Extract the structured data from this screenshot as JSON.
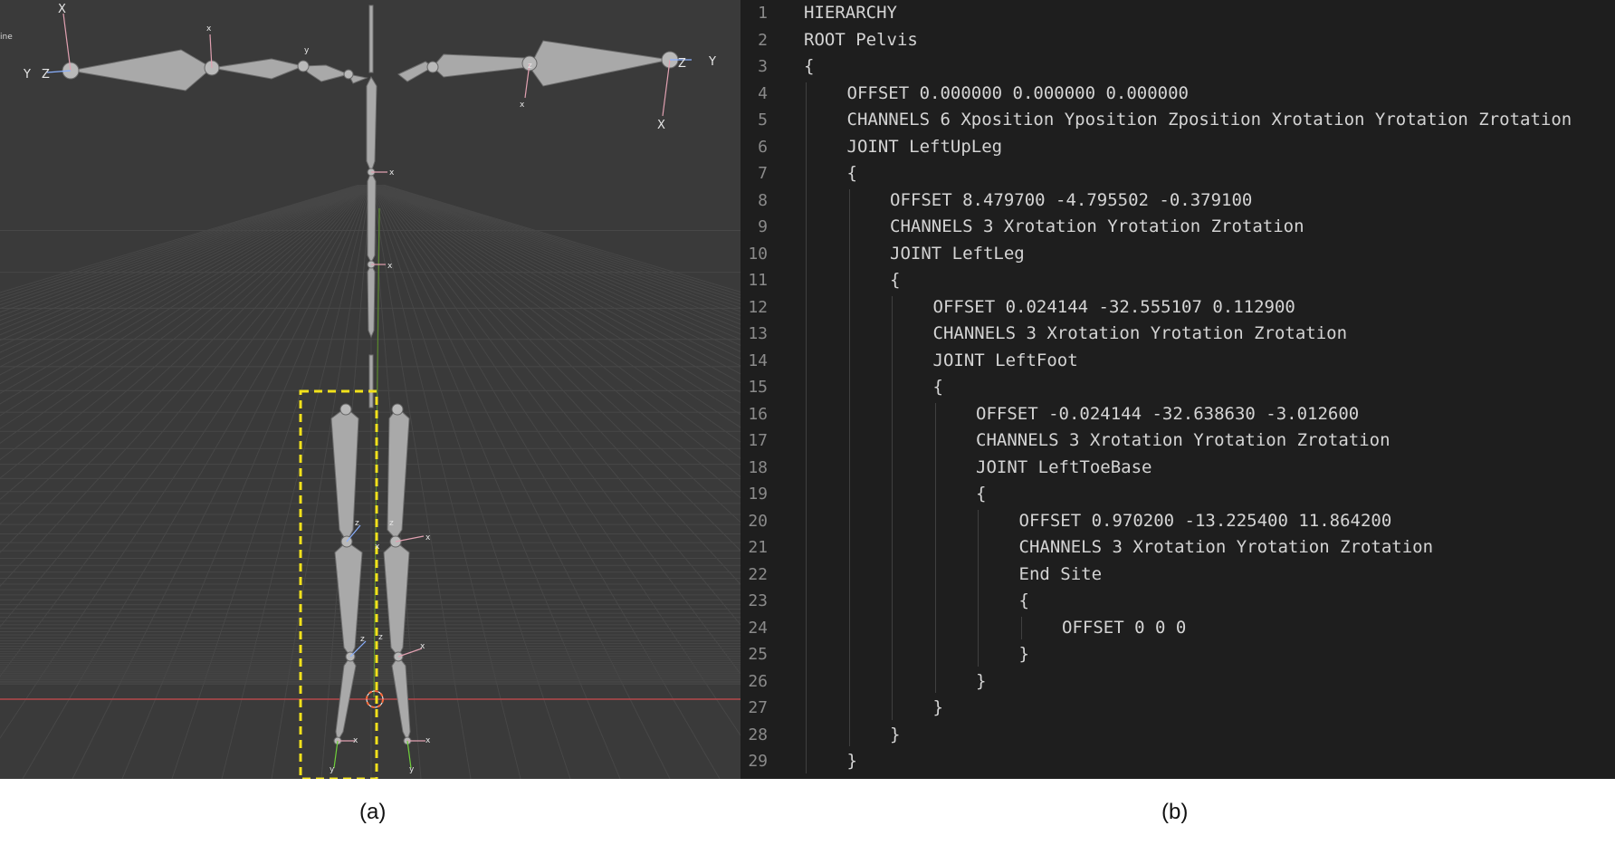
{
  "viewport": {
    "corner_text": "ine",
    "axis_labels": {
      "x": "X",
      "y": "Y",
      "z": "Z",
      "x_small": "x",
      "y_small": "y",
      "z_small": "z"
    },
    "colors": {
      "background": "#3a3a3a",
      "grid": "#4c4c4c",
      "bone": "#a9a9a9",
      "axis_x": "#ff5a5a",
      "axis_y": "#6fcf3b",
      "axis_z": "#6b8cff",
      "highlight_box": "#f2e11b"
    }
  },
  "editor": {
    "lines": [
      {
        "n": "1",
        "text": "HIERARCHY",
        "indent": 0
      },
      {
        "n": "2",
        "text": "ROOT Pelvis",
        "indent": 0
      },
      {
        "n": "3",
        "text": "{",
        "indent": 0
      },
      {
        "n": "4",
        "text": "OFFSET 0.000000 0.000000 0.000000",
        "indent": 1
      },
      {
        "n": "5",
        "text": "CHANNELS 6 Xposition Yposition Zposition Xrotation Yrotation Zrotation",
        "indent": 1
      },
      {
        "n": "6",
        "text": "JOINT LeftUpLeg",
        "indent": 1
      },
      {
        "n": "7",
        "text": "{",
        "indent": 1
      },
      {
        "n": "8",
        "text": "OFFSET 8.479700 -4.795502 -0.379100",
        "indent": 2
      },
      {
        "n": "9",
        "text": "CHANNELS 3 Xrotation Yrotation Zrotation",
        "indent": 2
      },
      {
        "n": "10",
        "text": "JOINT LeftLeg",
        "indent": 2
      },
      {
        "n": "11",
        "text": "{",
        "indent": 2
      },
      {
        "n": "12",
        "text": "OFFSET 0.024144 -32.555107 0.112900",
        "indent": 3
      },
      {
        "n": "13",
        "text": "CHANNELS 3 Xrotation Yrotation Zrotation",
        "indent": 3
      },
      {
        "n": "14",
        "text": "JOINT LeftFoot",
        "indent": 3
      },
      {
        "n": "15",
        "text": "{",
        "indent": 3
      },
      {
        "n": "16",
        "text": "OFFSET -0.024144 -32.638630 -3.012600",
        "indent": 4
      },
      {
        "n": "17",
        "text": "CHANNELS 3 Xrotation Yrotation Zrotation",
        "indent": 4
      },
      {
        "n": "18",
        "text": "JOINT LeftToeBase",
        "indent": 4
      },
      {
        "n": "19",
        "text": "{",
        "indent": 4
      },
      {
        "n": "20",
        "text": "OFFSET 0.970200 -13.225400 11.864200",
        "indent": 5
      },
      {
        "n": "21",
        "text": "CHANNELS 3 Xrotation Yrotation Zrotation",
        "indent": 5
      },
      {
        "n": "22",
        "text": "End Site",
        "indent": 5
      },
      {
        "n": "23",
        "text": "{",
        "indent": 5
      },
      {
        "n": "24",
        "text": "OFFSET 0 0 0",
        "indent": 6
      },
      {
        "n": "25",
        "text": "}",
        "indent": 5
      },
      {
        "n": "26",
        "text": "}",
        "indent": 4
      },
      {
        "n": "27",
        "text": "}",
        "indent": 3
      },
      {
        "n": "28",
        "text": "}",
        "indent": 2
      },
      {
        "n": "29",
        "text": "}",
        "indent": 1
      }
    ],
    "colors": {
      "background": "#1e1e1e",
      "text": "#d4d4d4",
      "line_number": "#8a8a8a",
      "indent_guide": "#404040"
    }
  },
  "captions": {
    "a": "(a)",
    "b": "(b)"
  }
}
